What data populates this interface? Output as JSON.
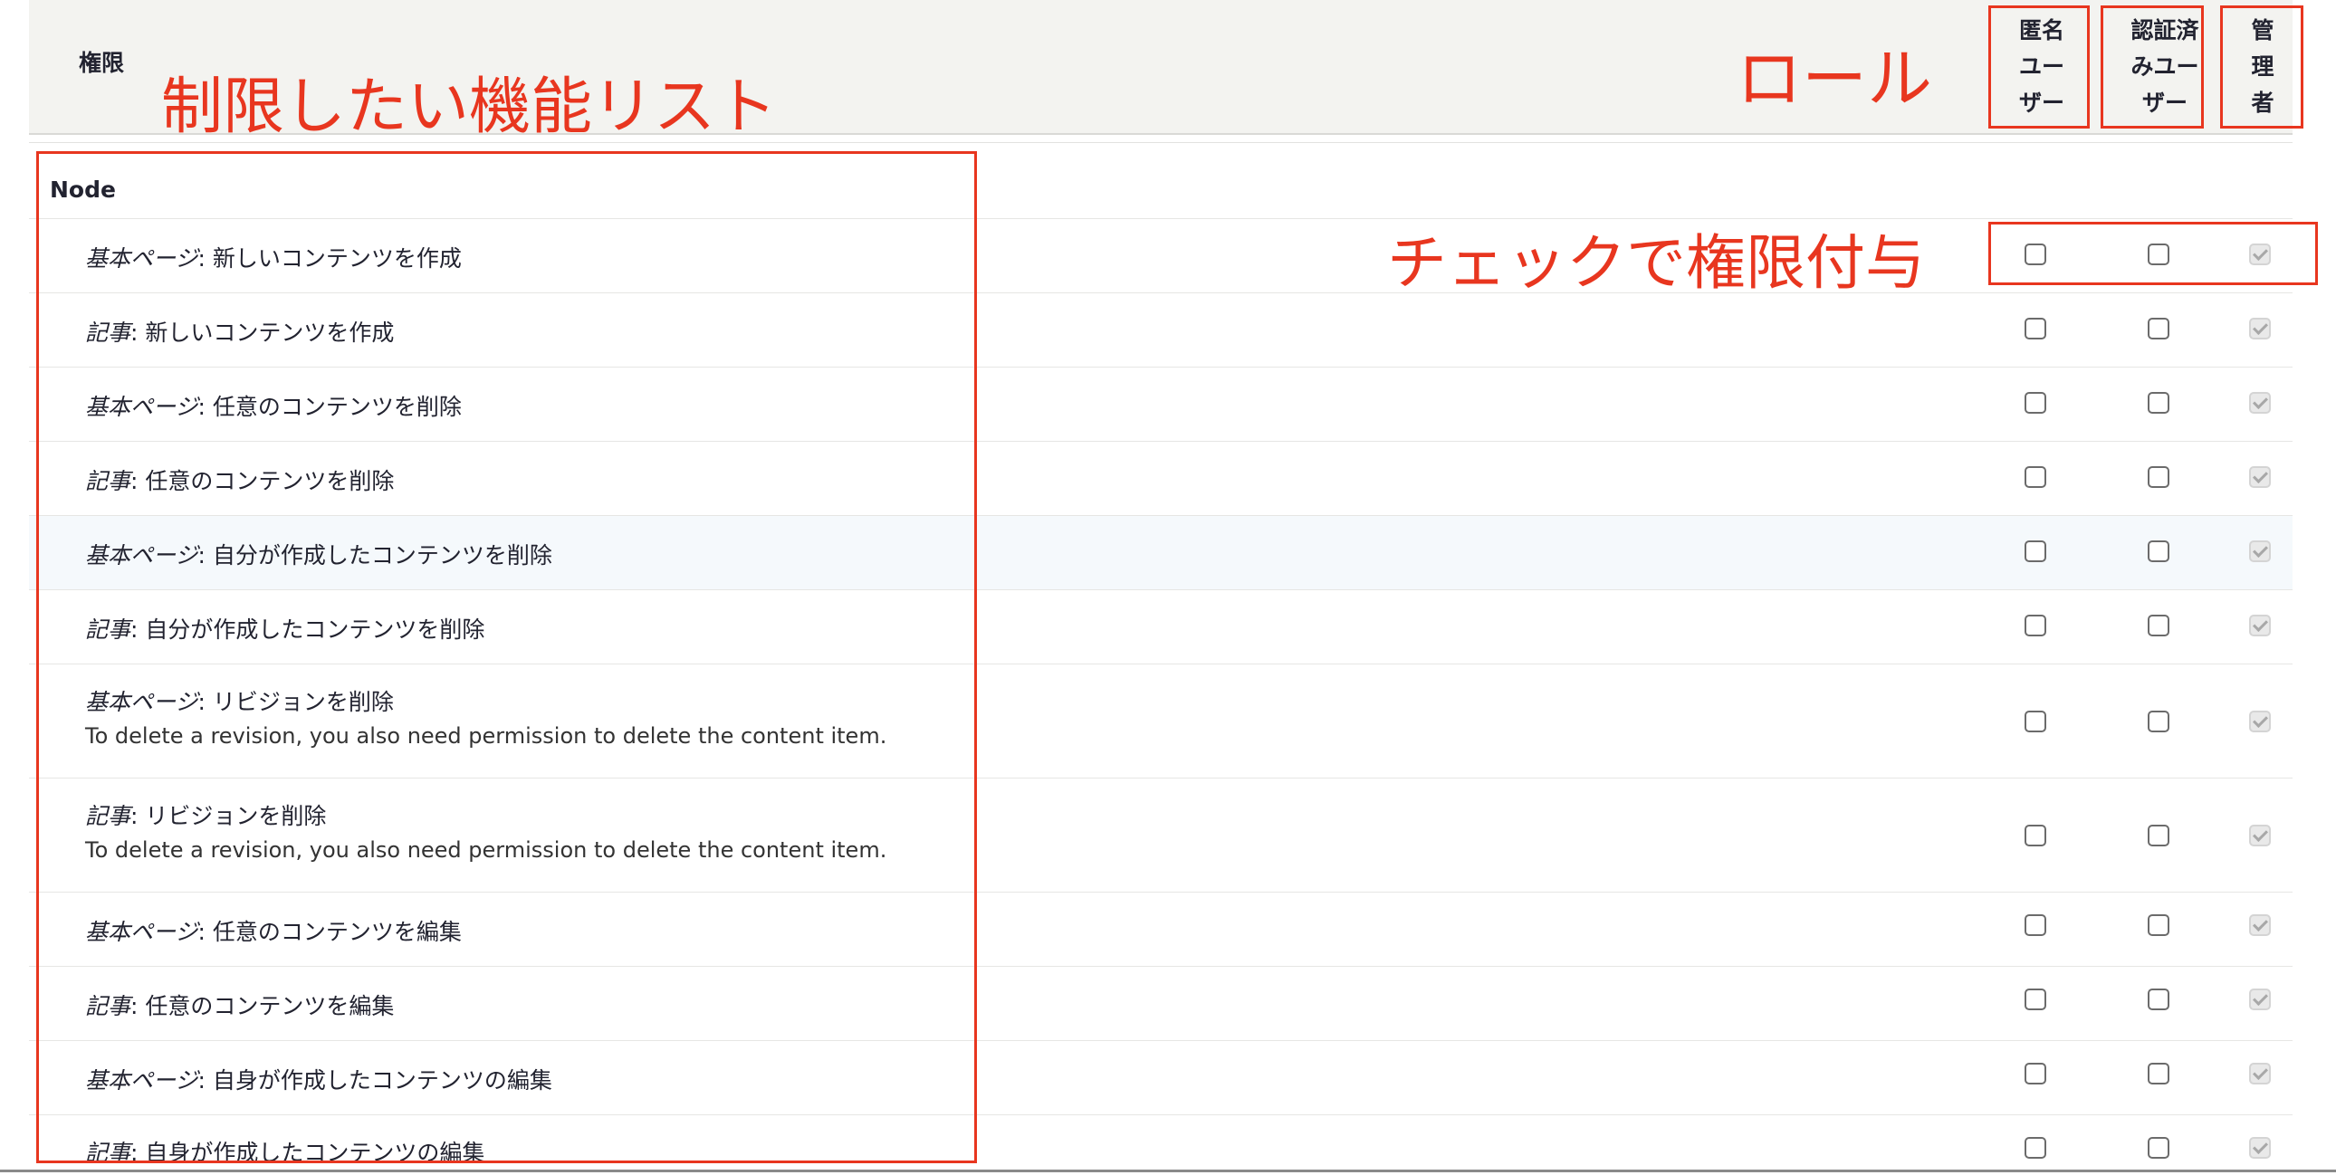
{
  "table": {
    "permission_column": "権限",
    "roles": [
      {
        "name_lines": [
          "匿名",
          "ユー",
          "ザー"
        ]
      },
      {
        "name_lines": [
          "認証済",
          "みユー",
          "ザー"
        ]
      },
      {
        "name_lines": [
          "管",
          "理",
          "者"
        ]
      }
    ],
    "group": "Node",
    "rows": [
      {
        "type": "基本ページ",
        "sep": ": ",
        "label": "新しいコンテンツを作成",
        "desc": "",
        "checked": [
          false,
          false,
          true
        ]
      },
      {
        "type": "記事",
        "sep": ": ",
        "label": "新しいコンテンツを作成",
        "desc": "",
        "checked": [
          false,
          false,
          true
        ]
      },
      {
        "type": "基本ページ",
        "sep": ": ",
        "label": "任意のコンテンツを削除",
        "desc": "",
        "checked": [
          false,
          false,
          true
        ]
      },
      {
        "type": "記事",
        "sep": ": ",
        "label": "任意のコンテンツを削除",
        "desc": "",
        "checked": [
          false,
          false,
          true
        ]
      },
      {
        "type": "基本ページ",
        "sep": ": ",
        "label": "自分が作成したコンテンツを削除",
        "desc": "",
        "checked": [
          false,
          false,
          true
        ]
      },
      {
        "type": "記事",
        "sep": ": ",
        "label": "自分が作成したコンテンツを削除",
        "desc": "",
        "checked": [
          false,
          false,
          true
        ]
      },
      {
        "type": "基本ページ",
        "sep": ": ",
        "label": "リビジョンを削除",
        "desc": "To delete a revision, you also need permission to delete the content item.",
        "checked": [
          false,
          false,
          true
        ]
      },
      {
        "type": "記事",
        "sep": ": ",
        "label": "リビジョンを削除",
        "desc": "To delete a revision, you also need permission to delete the content item.",
        "checked": [
          false,
          false,
          true
        ]
      },
      {
        "type": "基本ページ",
        "sep": ": ",
        "label": "任意のコンテンツを編集",
        "desc": "",
        "checked": [
          false,
          false,
          true
        ]
      },
      {
        "type": "記事",
        "sep": ": ",
        "label": "任意のコンテンツを編集",
        "desc": "",
        "checked": [
          false,
          false,
          true
        ]
      },
      {
        "type": "基本ページ",
        "sep": ": ",
        "label": "自身が作成したコンテンツの編集",
        "desc": "",
        "checked": [
          false,
          false,
          true
        ]
      },
      {
        "type": "記事",
        "sep": ": ",
        "label": "自身が作成したコンテンツの編集",
        "desc": "",
        "checked": [
          false,
          false,
          true
        ]
      }
    ]
  },
  "annotations": {
    "feature_list": "制限したい機能リスト",
    "roles": "ロール",
    "check_grant": "チェックで権限付与",
    "color": "#e8361f"
  }
}
